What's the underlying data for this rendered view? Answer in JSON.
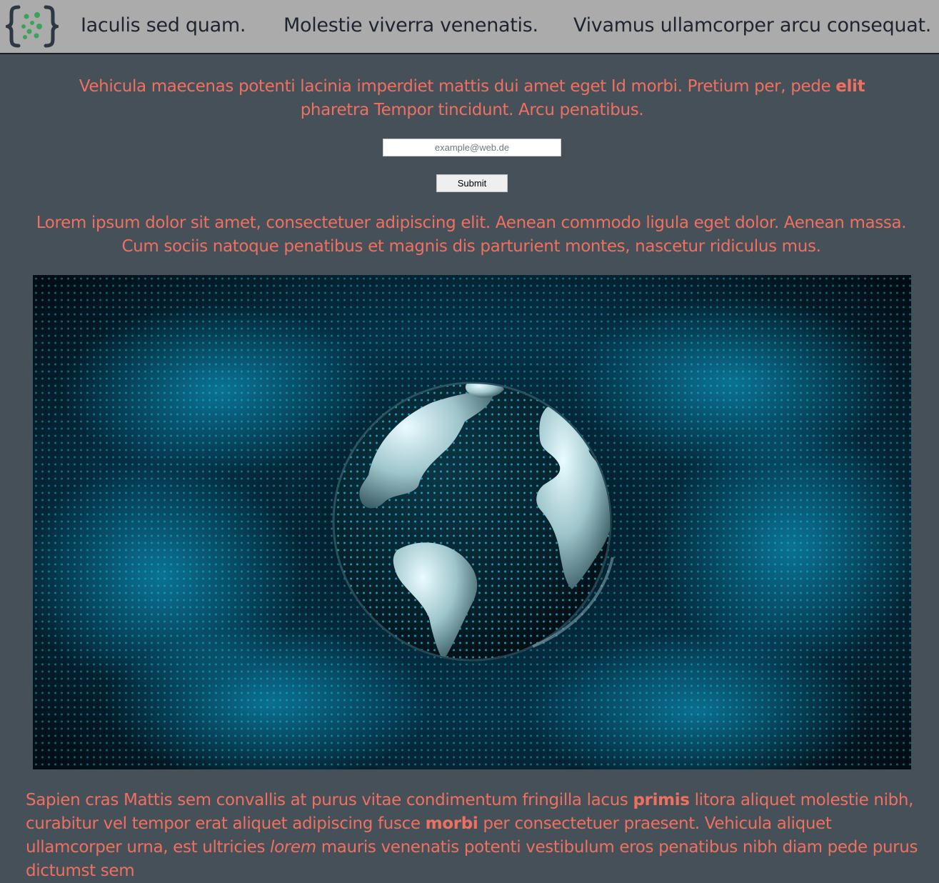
{
  "header": {
    "logo_icon": "curly-braces-dots-logo",
    "logo_colors": {
      "brace": "#2e3844",
      "dots": "#3aa35a"
    },
    "nav": [
      {
        "label": "Iaculis sed quam."
      },
      {
        "label": "Molestie viverra venenatis."
      },
      {
        "label": "Vivamus ullamcorper arcu consequat."
      }
    ]
  },
  "intro": {
    "text_1": "Vehicula maecenas potenti lacinia imperdiet mattis dui amet eget Id morbi. Pretium per, pede ",
    "bold_1": "elit",
    "text_2": " pharetra Tempor tincidunt. Arcu penatibus."
  },
  "form": {
    "email_placeholder": "example@web.de",
    "email_value": "",
    "submit_label": "Submit"
  },
  "lorem": {
    "text": "Lorem ipsum dolor sit amet, consectetuer adipiscing elit. Aenean commodo ligula eget dolor. Aenean massa. Cum sociis natoque penatibus et magnis dis parturient montes, nascetur ridiculus mus."
  },
  "hero": {
    "subject": "digital-globe-image",
    "colors": {
      "glow": "#0b8fb8",
      "dots": "#22d4e6",
      "bg": "#03111a"
    }
  },
  "bottom": {
    "text_1": "Sapien cras Mattis sem convallis at purus vitae condimentum fringilla lacus ",
    "bold_1": "primis",
    "text_2": " litora aliquet molestie nibh, curabitur vel tempor erat aliquet adipiscing fusce ",
    "bold_2": "morbi",
    "text_3": " per consectetuer praesent. Vehicula aliquet ullamcorper urna, est ultricies ",
    "italic_1": "lorem",
    "text_4": " mauris venenatis potenti vestibulum eros penatibus nibh diam pede purus dictumst sem"
  },
  "theme": {
    "page_bg": "#455058",
    "header_bg": "#ababab",
    "accent": "#f07060"
  }
}
